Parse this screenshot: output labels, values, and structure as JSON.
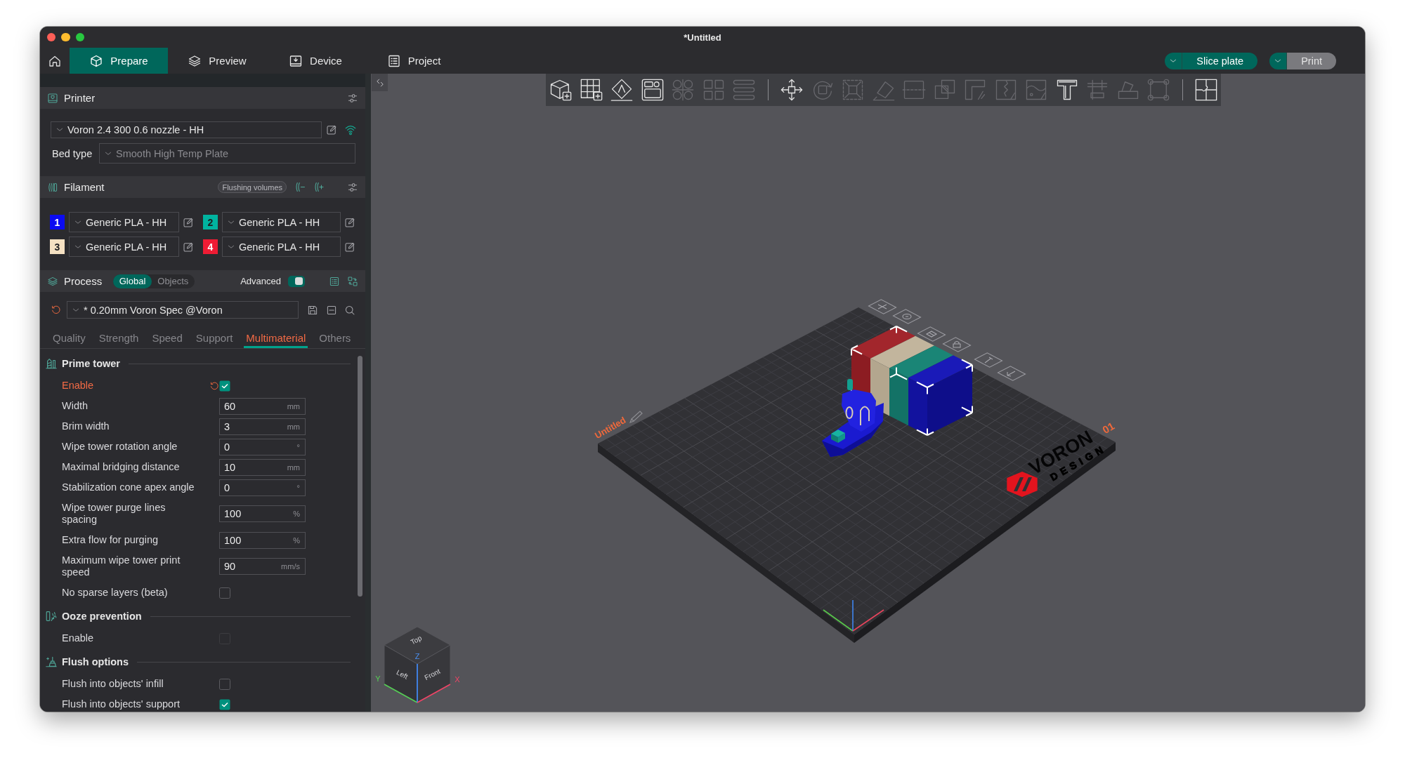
{
  "window": {
    "title": "*Untitled"
  },
  "main_tabs": [
    {
      "label": "Prepare",
      "selected": true
    },
    {
      "label": "Preview",
      "selected": false
    },
    {
      "label": "Device",
      "selected": false
    },
    {
      "label": "Project",
      "selected": false
    }
  ],
  "actions": [
    {
      "label": "Slice plate",
      "disabled": false
    },
    {
      "label": "Print",
      "disabled": true
    }
  ],
  "printer": {
    "title": "Printer",
    "preset": "Voron 2.4 300 0.6 nozzle - HH",
    "bed_type": {
      "label": "Bed type",
      "value": "Smooth High Temp Plate",
      "disabled": true
    }
  },
  "filament": {
    "title": "Filament",
    "flushing_button": "Flushing volumes",
    "slots": [
      {
        "number": "1",
        "color": "#0b0bf2",
        "preset": "Generic PLA - HH"
      },
      {
        "number": "2",
        "color": "#00b39f",
        "preset": "Generic PLA - HH"
      },
      {
        "number": "3",
        "color": "#f5e1c3",
        "preset": "Generic PLA - HH"
      },
      {
        "number": "4",
        "color": "#ee1c34",
        "preset": "Generic PLA - HH"
      }
    ]
  },
  "process": {
    "title": "Process",
    "scope": [
      {
        "label": "Global",
        "selected": true
      },
      {
        "label": "Objects",
        "selected": false
      }
    ],
    "advanced": {
      "label": "Advanced",
      "on": true
    },
    "preset": "* 0.20mm Voron Spec @Voron",
    "tabs": [
      {
        "label": "Quality",
        "selected": false
      },
      {
        "label": "Strength",
        "selected": false
      },
      {
        "label": "Speed",
        "selected": false
      },
      {
        "label": "Support",
        "selected": false
      },
      {
        "label": "Multimaterial",
        "selected": true
      },
      {
        "label": "Others",
        "selected": false
      }
    ]
  },
  "settings": [
    {
      "title": "Prime tower",
      "rows": [
        {
          "kind": "checkbox",
          "label": "Enable",
          "checked": true,
          "modified": true,
          "disabled": false
        },
        {
          "kind": "number",
          "label": "Width",
          "value": "60",
          "unit": "mm",
          "modified": false,
          "disabled": false
        },
        {
          "kind": "number",
          "label": "Brim width",
          "value": "3",
          "unit": "mm",
          "modified": false,
          "disabled": false
        },
        {
          "kind": "number",
          "label": "Wipe tower rotation angle",
          "value": "0",
          "unit": "°",
          "modified": false,
          "disabled": false
        },
        {
          "kind": "number",
          "label": "Maximal bridging distance",
          "value": "10",
          "unit": "mm",
          "modified": false,
          "disabled": false
        },
        {
          "kind": "number",
          "label": "Stabilization cone apex angle",
          "value": "0",
          "unit": "°",
          "modified": false,
          "disabled": false
        },
        {
          "kind": "number",
          "label": "Wipe tower purge lines spacing",
          "value": "100",
          "unit": "%",
          "modified": false,
          "disabled": false
        },
        {
          "kind": "number",
          "label": "Extra flow for purging",
          "value": "100",
          "unit": "%",
          "modified": false,
          "disabled": false
        },
        {
          "kind": "number",
          "label": "Maximum wipe tower print speed",
          "value": "90",
          "unit": "mm/s",
          "modified": false,
          "disabled": false
        },
        {
          "kind": "checkbox",
          "label": "No sparse layers (beta)",
          "checked": false,
          "modified": false,
          "disabled": false
        }
      ]
    },
    {
      "title": "Ooze prevention",
      "rows": [
        {
          "kind": "checkbox",
          "label": "Enable",
          "checked": false,
          "modified": false,
          "disabled": true
        }
      ]
    },
    {
      "title": "Flush options",
      "rows": [
        {
          "kind": "checkbox",
          "label": "Flush into objects' infill",
          "checked": false,
          "modified": false,
          "disabled": false
        },
        {
          "kind": "checkbox",
          "label": "Flush into objects' support",
          "checked": true,
          "modified": false,
          "disabled": false
        }
      ]
    }
  ],
  "viewport": {
    "toolbar": [
      {
        "items": [
          {
            "disabled": false
          },
          {
            "disabled": false
          },
          {
            "disabled": false
          },
          {
            "disabled": false
          },
          {
            "disabled": true
          },
          {
            "disabled": true
          },
          {
            "disabled": true
          }
        ]
      },
      {
        "items": [
          {
            "disabled": false
          },
          {
            "disabled": true
          },
          {
            "disabled": true
          },
          {
            "disabled": true
          },
          {
            "disabled": true
          },
          {
            "disabled": true
          },
          {
            "disabled": true
          },
          {
            "disabled": true
          },
          {
            "disabled": true
          },
          {
            "disabled": false
          },
          {
            "disabled": true
          },
          {
            "disabled": true
          },
          {
            "disabled": true
          }
        ]
      },
      {
        "items": [
          {
            "disabled": false
          }
        ]
      }
    ],
    "plate": {
      "name": "Untitled",
      "number": "01",
      "logo": [
        "VORON",
        "DESIGN"
      ]
    },
    "view_cube": {
      "faces": [
        "Top",
        "Left",
        "Front"
      ],
      "axes": [
        "Z",
        "Y",
        "X"
      ]
    }
  }
}
